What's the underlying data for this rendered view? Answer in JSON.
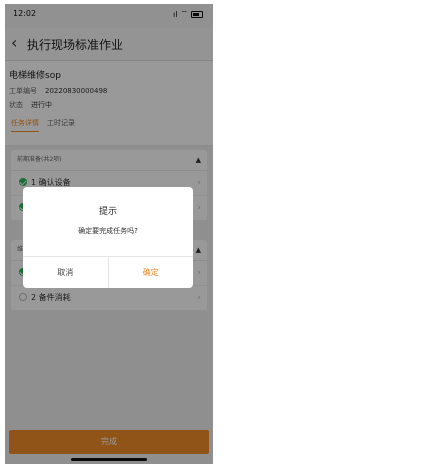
{
  "status_bar": {
    "time": "12:02",
    "signal": "ıl",
    "wifi": "⌔"
  },
  "nav": {
    "back_icon": "chevron-left",
    "title": "执行现场标准作业"
  },
  "work_order": {
    "name": "电梯维修sop",
    "order_label": "工单编号",
    "order_number": "20220830000498",
    "state_label": "状态",
    "state_value": "进行中"
  },
  "tabs": [
    {
      "label": "任务详情",
      "active": true
    },
    {
      "label": "工时记录",
      "active": false
    }
  ],
  "sections": [
    {
      "title": "前期准备(共2项)",
      "tasks": [
        {
          "label": "1 确认设备",
          "status": "done"
        },
        {
          "label": "",
          "status": "done"
        }
      ]
    },
    {
      "title": "维",
      "tasks": [
        {
          "label": "",
          "status": "done"
        },
        {
          "label": "2 备件消耗",
          "status": "pending"
        }
      ]
    }
  ],
  "bottom_button": {
    "label": "完成"
  },
  "dialog": {
    "title": "提示",
    "message": "确定要完成任务吗?",
    "cancel_label": "取消",
    "confirm_label": "确定"
  },
  "colors": {
    "accent": "#f08b28",
    "success": "#28b45a"
  }
}
